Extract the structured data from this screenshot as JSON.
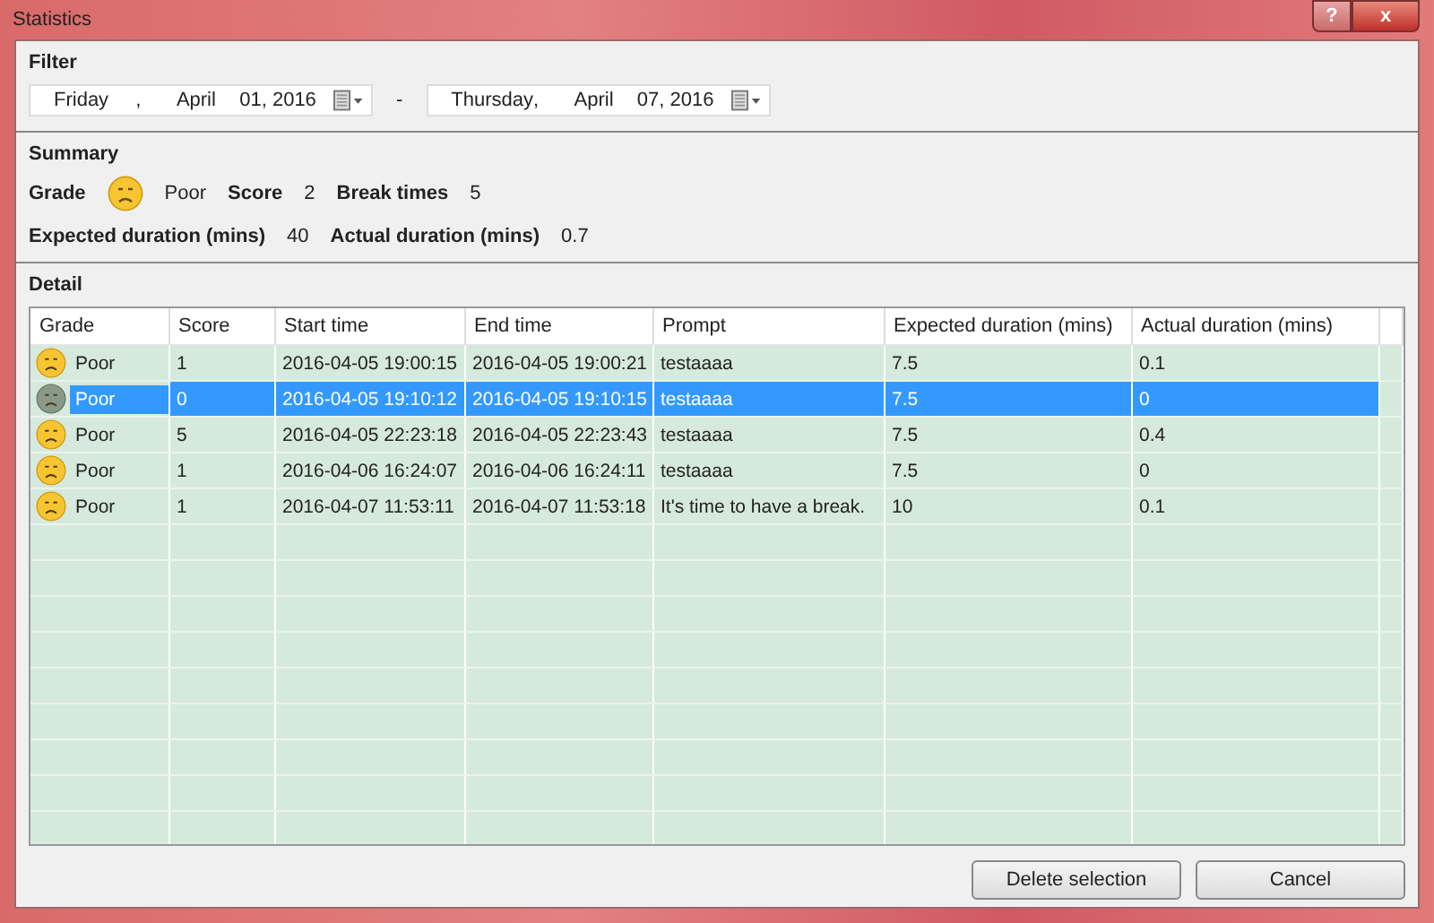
{
  "window": {
    "title": "Statistics",
    "buttons": [
      "?",
      "x"
    ]
  },
  "filter": {
    "title": "Filter",
    "from": {
      "weekday": "Friday",
      "sep": ",",
      "month": "April",
      "day": "01, 2016"
    },
    "dash": "-",
    "to": {
      "weekday": "Thursday",
      "sep": ",",
      "month": "April",
      "day": "07, 2016"
    }
  },
  "summary": {
    "title": "Summary",
    "grade_label": "Grade",
    "grade": "Poor",
    "score_label": "Score",
    "score": "2",
    "break_label": "Break times",
    "breaks": "5",
    "expected_label": "Expected duration (mins)",
    "expected": "40",
    "actual_label": "Actual duration (mins)",
    "actual": "0.7"
  },
  "detail": {
    "title": "Detail",
    "columns": [
      "Grade",
      "Score",
      "Start time",
      "End time",
      "Prompt",
      "Expected duration (mins)",
      "Actual duration (mins)"
    ],
    "rows": [
      {
        "grade": "Poor",
        "score": "1",
        "start": "2016-04-05 19:00:15",
        "end": "2016-04-05 19:00:21",
        "prompt": "testaaaa",
        "expected": "7.5",
        "actual": "0.1",
        "selected": false
      },
      {
        "grade": "Poor",
        "score": "0",
        "start": "2016-04-05 19:10:12",
        "end": "2016-04-05 19:10:15",
        "prompt": "testaaaa",
        "expected": "7.5",
        "actual": "0",
        "selected": true
      },
      {
        "grade": "Poor",
        "score": "5",
        "start": "2016-04-05 22:23:18",
        "end": "2016-04-05 22:23:43",
        "prompt": "testaaaa",
        "expected": "7.5",
        "actual": "0.4",
        "selected": false
      },
      {
        "grade": "Poor",
        "score": "1",
        "start": "2016-04-06 16:24:07",
        "end": "2016-04-06 16:24:11",
        "prompt": "testaaaa",
        "expected": "7.5",
        "actual": "0",
        "selected": false
      },
      {
        "grade": "Poor",
        "score": "1",
        "start": "2016-04-07 11:53:11",
        "end": "2016-04-07 11:53:18",
        "prompt": "It's time to have a break.",
        "expected": "10",
        "actual": "0.1",
        "selected": false
      }
    ]
  },
  "buttons": [
    "Delete selection",
    "Cancel"
  ]
}
